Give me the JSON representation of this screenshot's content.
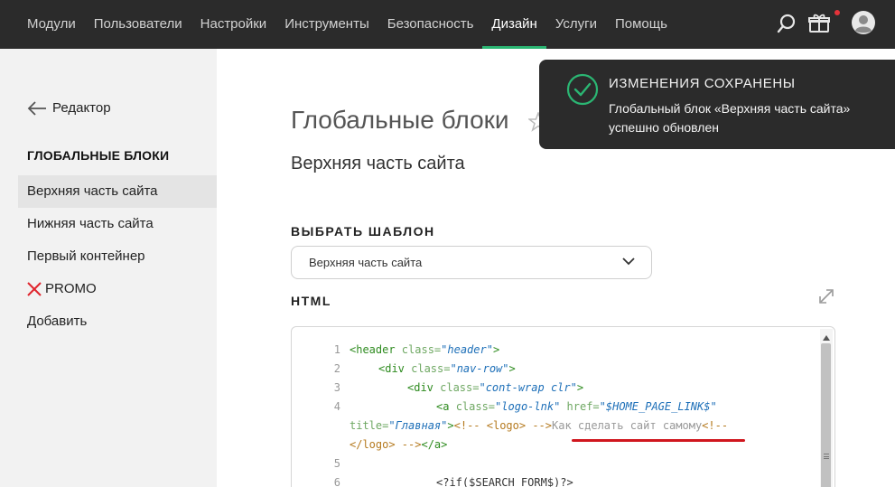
{
  "nav": {
    "items": [
      {
        "label": "Модули",
        "active": false
      },
      {
        "label": "Пользователи",
        "active": false
      },
      {
        "label": "Настройки",
        "active": false
      },
      {
        "label": "Инструменты",
        "active": false
      },
      {
        "label": "Безопасность",
        "active": false
      },
      {
        "label": "Дизайн",
        "active": true
      },
      {
        "label": "Услуги",
        "active": false
      },
      {
        "label": "Помощь",
        "active": false
      }
    ],
    "icons": [
      "search-icon",
      "gift-icon",
      "user-avatar-icon"
    ],
    "accent_color": "#2bb673",
    "notification_color": "#e5333a"
  },
  "sidebar": {
    "back_label": "Редактор",
    "title": "ГЛОБАЛЬНЫЕ БЛОКИ",
    "items": [
      {
        "label": "Верхняя часть сайта",
        "active": true
      },
      {
        "label": "Нижняя часть сайта",
        "active": false
      },
      {
        "label": "Первый контейнер",
        "active": false
      },
      {
        "label": "PROMO",
        "active": false,
        "icon": "red-x-icon"
      },
      {
        "label": "Добавить",
        "active": false
      }
    ]
  },
  "main": {
    "title": "Глобальные блоки",
    "subtitle": "Верхняя часть сайта",
    "template_label": "ВЫБРАТЬ ШАБЛОН",
    "template_selected": "Верхняя часть сайта",
    "html_label": "HTML"
  },
  "editor": {
    "line_numbers": [
      "1",
      "2",
      "3",
      "4",
      "5",
      "6"
    ],
    "tokens": {
      "l1_tag": "<header ",
      "l1_attr": "class=",
      "l1_val": "\"header\"",
      "l1_end": ">",
      "l2_tag": "<div ",
      "l2_attr": "class=",
      "l2_val": "\"nav-row\"",
      "l2_end": ">",
      "l3_tag": "<div ",
      "l3_attr": "class=",
      "l3_val": "\"cont-wrap clr\"",
      "l3_end": ">",
      "l4_tag": "<a ",
      "l4_attr1": "class=",
      "l4_val1": "\"logo-lnk\"",
      "l4_attr2": " href=",
      "l4_val2": "\"$HOME_PAGE_LINK$\"",
      "l4b_attr": "title=",
      "l4b_val": "\"Главная\"",
      "l4b_end": ">",
      "l4b_cmt": "<!-- <logo> -->",
      "l4b_text": "Как сделать сайт самому",
      "l4b_cmt2": "<!--",
      "l4c_cmt": "</logo> -->",
      "l4c_end": "</a>",
      "l6_php": "<?if($SEARCH_FORM$)?>"
    }
  },
  "toast": {
    "title": "ИЗМЕНЕНИЯ СОХРАНЕНЫ",
    "message": "Глобальный блок «Верхняя часть сайта» успешно обновлен",
    "icon": "check-circle-icon",
    "icon_color": "#2bb673"
  }
}
